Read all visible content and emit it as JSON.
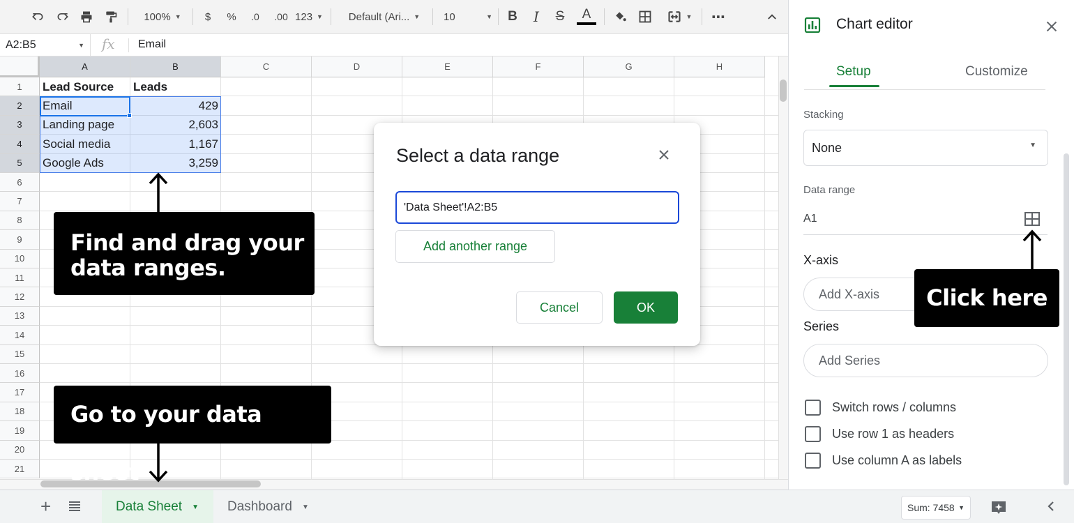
{
  "toolbar": {
    "zoom": "100%",
    "currency": "$",
    "percent": "%",
    "decrease_decimals": ".0",
    "increase_decimals": ".00",
    "more_formats": "123",
    "font": "Default (Ari...",
    "font_size": "10",
    "bold": "B",
    "italic": "I",
    "strikethrough": "S",
    "text_color": "A",
    "more": "⋯",
    "icons": [
      "undo-icon",
      "redo-icon",
      "print-icon",
      "paint-format-icon",
      "fill-color-icon",
      "borders-icon",
      "merge-cells-icon",
      "collapse-toolbar-icon"
    ]
  },
  "formula_bar": {
    "name_box": "A2:B5",
    "fx": "fx",
    "value": "Email"
  },
  "grid": {
    "columns": [
      "A",
      "B",
      "C",
      "D",
      "E",
      "F",
      "G",
      "H"
    ],
    "rows": [
      "1",
      "2",
      "3",
      "4",
      "5",
      "6",
      "7",
      "8",
      "9",
      "10",
      "11",
      "12",
      "13",
      "14",
      "15",
      "16",
      "17",
      "18",
      "19",
      "20",
      "21"
    ],
    "cells": {
      "A1": "Lead Source",
      "B1": "Leads",
      "A2": "Email",
      "B2": "429",
      "A3": "Landing page",
      "B3": "2,603",
      "A4": "Social media",
      "B4": "1,167",
      "A5": "Google Ads",
      "B5": "3,259"
    }
  },
  "dialog": {
    "title": "Select a data range",
    "range_value": "'Data Sheet'!A2:B5",
    "add_range": "Add another range",
    "cancel": "Cancel",
    "ok": "OK"
  },
  "chart_editor": {
    "title": "Chart editor",
    "tabs": [
      "Setup",
      "Customize"
    ],
    "stacking_label": "Stacking",
    "stacking_value": "None",
    "data_range_label": "Data range",
    "data_range_value": "A1",
    "xaxis_heading": "X-axis",
    "xaxis_button": "Add X-axis",
    "series_heading": "Series",
    "series_button": "Add Series",
    "checkboxes": [
      "Switch rows / columns",
      "Use row 1 as headers",
      "Use column A as labels"
    ]
  },
  "sheet_bar": {
    "add": "+",
    "tabs": [
      "Data Sheet",
      "Dashboard"
    ],
    "sum": "Sum: 7458"
  },
  "annotations": {
    "find_drag": "Find and drag your data ranges.",
    "go_to_sheet": "Go to your data sheet",
    "click_here": "Click here"
  },
  "colors": {
    "accent_green": "#188038",
    "selection_blue": "#1a73e8",
    "range_input_border": "#1a48d8"
  }
}
